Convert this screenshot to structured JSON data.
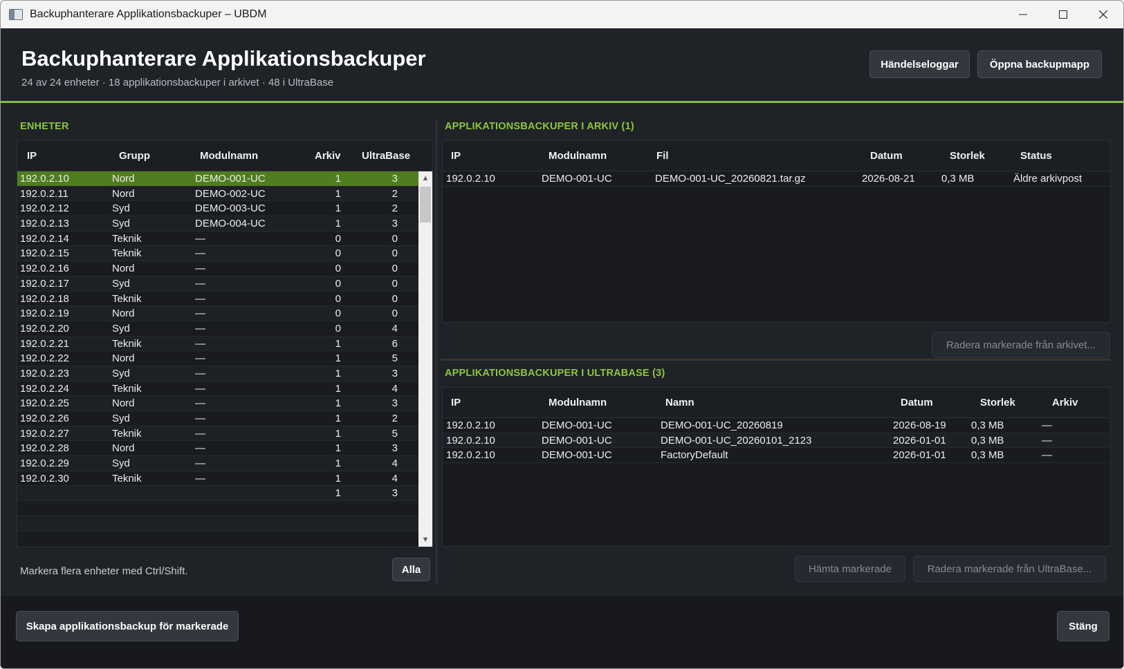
{
  "window": {
    "title": "Backuphanterare Applikationsbackuper – UBDM"
  },
  "header": {
    "title": "Backuphanterare Applikationsbackuper",
    "subtitle": "24 av 24 enheter · 18 applikationsbackuper i arkivet · 48 i UltraBase",
    "event_log_label": "Händelseloggar",
    "open_folder_label": "Öppna backupmapp"
  },
  "devices": {
    "title": "ENHETER",
    "columns": [
      "IP",
      "Grupp",
      "Modulnamn",
      "Arkiv",
      "UltraBase"
    ],
    "rows": [
      [
        "192.0.2.10",
        "Nord",
        "DEMO-001-UC",
        "1",
        "3"
      ],
      [
        "192.0.2.11",
        "Nord",
        "DEMO-002-UC",
        "1",
        "2"
      ],
      [
        "192.0.2.12",
        "Syd",
        "DEMO-003-UC",
        "1",
        "2"
      ],
      [
        "192.0.2.13",
        "Syd",
        "DEMO-004-UC",
        "1",
        "3"
      ],
      [
        "192.0.2.14",
        "Teknik",
        "—",
        "0",
        "0"
      ],
      [
        "192.0.2.15",
        "Teknik",
        "—",
        "0",
        "0"
      ],
      [
        "192.0.2.16",
        "Nord",
        "—",
        "0",
        "0"
      ],
      [
        "192.0.2.17",
        "Syd",
        "—",
        "0",
        "0"
      ],
      [
        "192.0.2.18",
        "Teknik",
        "—",
        "0",
        "0"
      ],
      [
        "192.0.2.19",
        "Nord",
        "—",
        "0",
        "0"
      ],
      [
        "192.0.2.20",
        "Syd",
        "—",
        "0",
        "4"
      ],
      [
        "192.0.2.21",
        "Teknik",
        "—",
        "1",
        "6"
      ],
      [
        "192.0.2.22",
        "Nord",
        "—",
        "1",
        "5"
      ],
      [
        "192.0.2.23",
        "Syd",
        "—",
        "1",
        "3"
      ],
      [
        "192.0.2.24",
        "Teknik",
        "—",
        "1",
        "4"
      ],
      [
        "192.0.2.25",
        "Nord",
        "—",
        "1",
        "3"
      ],
      [
        "192.0.2.26",
        "Syd",
        "—",
        "1",
        "2"
      ],
      [
        "192.0.2.27",
        "Teknik",
        "—",
        "1",
        "5"
      ],
      [
        "192.0.2.28",
        "Nord",
        "—",
        "1",
        "3"
      ],
      [
        "192.0.2.29",
        "Syd",
        "—",
        "1",
        "4"
      ],
      [
        "192.0.2.30",
        "Teknik",
        "—",
        "1",
        "4"
      ],
      [
        "",
        "",
        "",
        "1",
        "3"
      ],
      [
        "",
        "",
        "",
        "",
        ""
      ],
      [
        "",
        "",
        "",
        "",
        ""
      ]
    ],
    "hint": "Markera flera enheter med Ctrl/Shift.",
    "all_label": "Alla"
  },
  "archive": {
    "title": "APPLIKATIONSBACKUPER I ARKIV (1)",
    "columns": [
      "IP",
      "Modulnamn",
      "Fil",
      "Datum",
      "Storlek",
      "Status"
    ],
    "rows": [
      [
        "192.0.2.10",
        "DEMO-001-UC",
        "DEMO-001-UC_20260821.tar.gz",
        "2026-08-21",
        "0,3 MB",
        "Äldre arkivpost"
      ]
    ],
    "delete_label": "Radera markerade från arkivet..."
  },
  "ultrabase": {
    "title": "APPLIKATIONSBACKUPER I ULTRABASE (3)",
    "columns": [
      "IP",
      "Modulnamn",
      "Namn",
      "Datum",
      "Storlek",
      "Arkiv"
    ],
    "rows": [
      [
        "192.0.2.10",
        "DEMO-001-UC",
        "DEMO-001-UC_20260819",
        "2026-08-19",
        "0,3 MB",
        "—"
      ],
      [
        "192.0.2.10",
        "DEMO-001-UC",
        "DEMO-001-UC_20260101_2123",
        "2026-01-01",
        "0,3 MB",
        "—"
      ],
      [
        "192.0.2.10",
        "DEMO-001-UC",
        "FactoryDefault",
        "2026-01-01",
        "0,3 MB",
        "—"
      ]
    ],
    "fetch_label": "Hämta markerade",
    "delete_label": "Radera markerade från UltraBase..."
  },
  "footer": {
    "create_label": "Skapa applikationsbackup för markerade",
    "close_label": "Stäng"
  }
}
